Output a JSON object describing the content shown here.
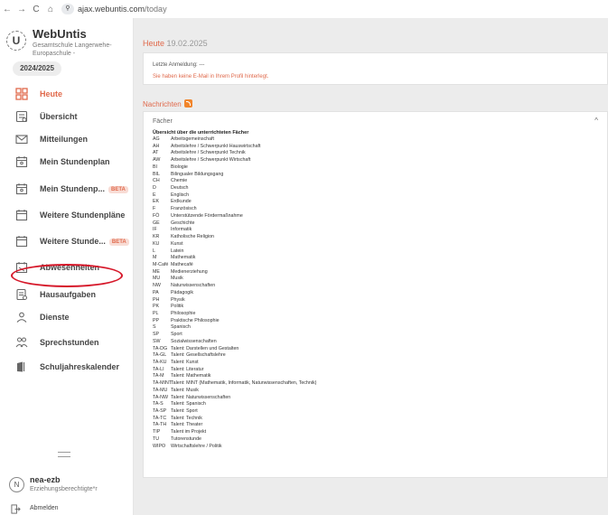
{
  "browser": {
    "back": "←",
    "forward": "→",
    "reload": "C",
    "home": "⌂",
    "tune": "⚲",
    "url_host": "ajax.webuntis.com",
    "url_path": "/today"
  },
  "school": {
    "logo_letter": "U",
    "app_name": "WebUntis",
    "subtitle": "Gesamtschule Langerwehe-Europaschule -",
    "year": "2024/2025"
  },
  "menu": [
    {
      "label": "Heute",
      "icon": "grid-icon",
      "active": true
    },
    {
      "label": "Übersicht",
      "icon": "overview-icon"
    },
    {
      "label": "Mitteilungen",
      "icon": "mail-icon"
    },
    {
      "label": "Mein Stundenplan",
      "icon": "calendar-user-icon"
    },
    {
      "label": "Mein Stundenp...",
      "icon": "calendar-user-icon",
      "badge": "BETA"
    },
    {
      "label": "Weitere Stundenpläne",
      "icon": "calendar-icon"
    },
    {
      "label": "Weitere Stunde...",
      "icon": "calendar-icon",
      "badge": "BETA"
    },
    {
      "label": "Abwesenheiten",
      "icon": "absence-icon"
    },
    {
      "label": "Hausaufgaben",
      "icon": "homework-icon"
    },
    {
      "label": "Dienste",
      "icon": "duties-icon"
    },
    {
      "label": "Sprechstunden",
      "icon": "office-hours-icon"
    },
    {
      "label": "Schuljahreskalender",
      "icon": "year-calendar-icon"
    }
  ],
  "user": {
    "avatar_letter": "N",
    "name": "nea-ezb",
    "role": "Erziehungsberechtigte*r",
    "logout": "Abmelden"
  },
  "main": {
    "title": "Heute",
    "date": "19.02.2025",
    "last_login": "Letzte Anmeldung: ---",
    "email_warning": "Sie haben keine E-Mail in Ihrem Profil hinterlegt.",
    "news_title": "Nachrichten",
    "subjects_title": "Fächer",
    "subjects_chevron": "^",
    "subjects_heading": "Übersicht über die unterrichteten Fächer"
  },
  "subjects": [
    {
      "code": "AG",
      "name": "Arbeitsgemeinschaft"
    },
    {
      "code": "AH",
      "name": "Arbeitslehre / Schwerpunkt Hauswirtschaft"
    },
    {
      "code": "AT",
      "name": "Arbeitslehre / Schwerpunkt Technik"
    },
    {
      "code": "AW",
      "name": "Arbeitslehre / Schwerpunkt Wirtschaft"
    },
    {
      "code": "BI",
      "name": "Biologie"
    },
    {
      "code": "BIL",
      "name": "Bilingualer Bildungsgang"
    },
    {
      "code": "CH",
      "name": "Chemie"
    },
    {
      "code": "D",
      "name": "Deutsch"
    },
    {
      "code": "E",
      "name": "Englisch"
    },
    {
      "code": "EK",
      "name": "Erdkunde"
    },
    {
      "code": "F",
      "name": "Französisch"
    },
    {
      "code": "FÖ",
      "name": "Unterstützende Fördermaßnahme"
    },
    {
      "code": "GE",
      "name": "Geschichte"
    },
    {
      "code": "IF",
      "name": "Informatik"
    },
    {
      "code": "KR",
      "name": "Katholische Religion"
    },
    {
      "code": "KU",
      "name": "Kunst"
    },
    {
      "code": "L",
      "name": "Latein"
    },
    {
      "code": "M",
      "name": "Mathematik"
    },
    {
      "code": "M-Café",
      "name": "Mathecafé"
    },
    {
      "code": "ME",
      "name": "Medienerziehung"
    },
    {
      "code": "MU",
      "name": "Musik"
    },
    {
      "code": "NW",
      "name": "Naturwissenschaften"
    },
    {
      "code": "PA",
      "name": "Pädagogik"
    },
    {
      "code": "PH",
      "name": "Physik"
    },
    {
      "code": "PK",
      "name": "Politik"
    },
    {
      "code": "PL",
      "name": "Philosophie"
    },
    {
      "code": "PP",
      "name": "Praktische Philosophie"
    },
    {
      "code": "S",
      "name": "Spanisch"
    },
    {
      "code": "SP",
      "name": "Sport"
    },
    {
      "code": "SW",
      "name": "Sozialwissenschaften"
    },
    {
      "code": "TA-DG",
      "name": "Talent: Darstellen und Gestalten"
    },
    {
      "code": "TA-GL",
      "name": "Talent: Gesellschaftslehre"
    },
    {
      "code": "TA-KU",
      "name": "Talent: Kunst"
    },
    {
      "code": "TA-LI",
      "name": "Talent: Literatur"
    },
    {
      "code": "TA-M",
      "name": "Talent: Mathematik"
    },
    {
      "code": "TA-MINT",
      "name": "Talent: MINT (Mathematik, Informatik, Naturwissenschaften, Technik)"
    },
    {
      "code": "TA-MU",
      "name": "Talent: Musik"
    },
    {
      "code": "TA-NW",
      "name": "Talent: Naturwissenschaften"
    },
    {
      "code": "TA-S",
      "name": "Talent: Spanisch"
    },
    {
      "code": "TA-SP",
      "name": "Talent: Sport"
    },
    {
      "code": "TA-TC",
      "name": "Talent: Technik"
    },
    {
      "code": "TA-TH",
      "name": "Talent: Theater"
    },
    {
      "code": "TIP",
      "name": "Talent im Projekt"
    },
    {
      "code": "TU",
      "name": "Tutorenstunde"
    },
    {
      "code": "WIPO",
      "name": "Wirtschaftslehre / Politik"
    }
  ],
  "colors": {
    "accent": "#e0694b",
    "highlight": "#d6182a",
    "rss": "#f1852b"
  }
}
